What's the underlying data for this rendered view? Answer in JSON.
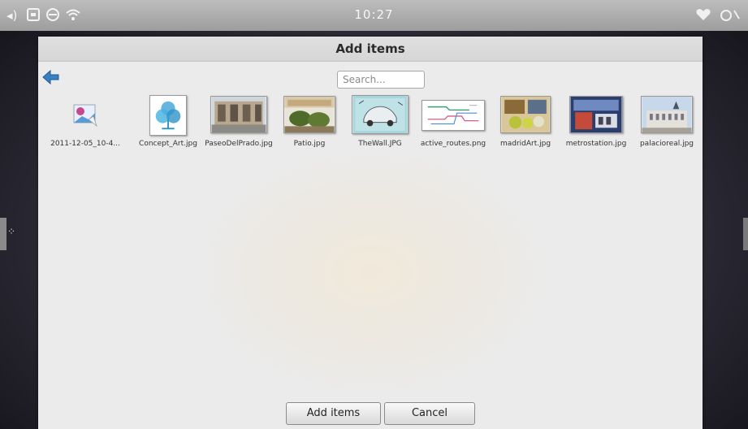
{
  "status_bar": {
    "time": "10:27",
    "left_icons": [
      "volume-icon",
      "notification-icon",
      "sync-icon",
      "wifi-icon"
    ],
    "right_icons": [
      "heart-icon",
      "settings-icon"
    ]
  },
  "dialog": {
    "title": "Add items",
    "search": {
      "placeholder": "Search...",
      "value": ""
    },
    "items": [
      {
        "label": "2011-12-05_10-4...",
        "thumb": "image-file-icon"
      },
      {
        "label": "Concept_Art.jpg",
        "thumb": "concept-art"
      },
      {
        "label": "PaseoDelPrado.jpg",
        "thumb": "photo"
      },
      {
        "label": "Patio.jpg",
        "thumb": "photo"
      },
      {
        "label": "TheWall.JPG",
        "thumb": "photo"
      },
      {
        "label": "active_routes.png",
        "thumb": "routes"
      },
      {
        "label": "madridArt.jpg",
        "thumb": "photo"
      },
      {
        "label": "metrostation.jpg",
        "thumb": "photo"
      },
      {
        "label": "palacioreal.jpg",
        "thumb": "photo"
      }
    ],
    "buttons": {
      "add": "Add items",
      "cancel": "Cancel"
    }
  },
  "colors": {
    "accent_arrow": "#3a7fc4",
    "dialog_bg": "#ebebeb",
    "status_bar": "#aaaaaa"
  }
}
